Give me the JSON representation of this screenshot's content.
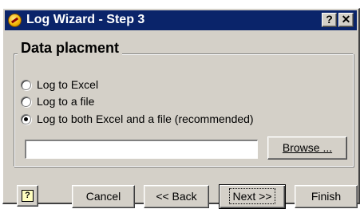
{
  "window": {
    "title": "Log Wizard - Step 3",
    "icon": "clock-icon",
    "title_buttons": {
      "help": "?",
      "close": "✕"
    }
  },
  "group": {
    "title": "Data placment",
    "options": [
      {
        "label": "Log to Excel",
        "checked": false
      },
      {
        "label": "Log to a file",
        "checked": false
      },
      {
        "label": "Log to both Excel and a file (recommended)",
        "checked": true
      }
    ]
  },
  "file": {
    "path_value": "",
    "browse_label": "Browse ..."
  },
  "footer": {
    "help_glyph": "?",
    "cancel_label": "Cancel",
    "back_label": "<< Back",
    "next_label": "Next >>",
    "finish_label": "Finish"
  },
  "colors": {
    "titlebar": "#0a246a",
    "face": "#d4d0c8"
  }
}
